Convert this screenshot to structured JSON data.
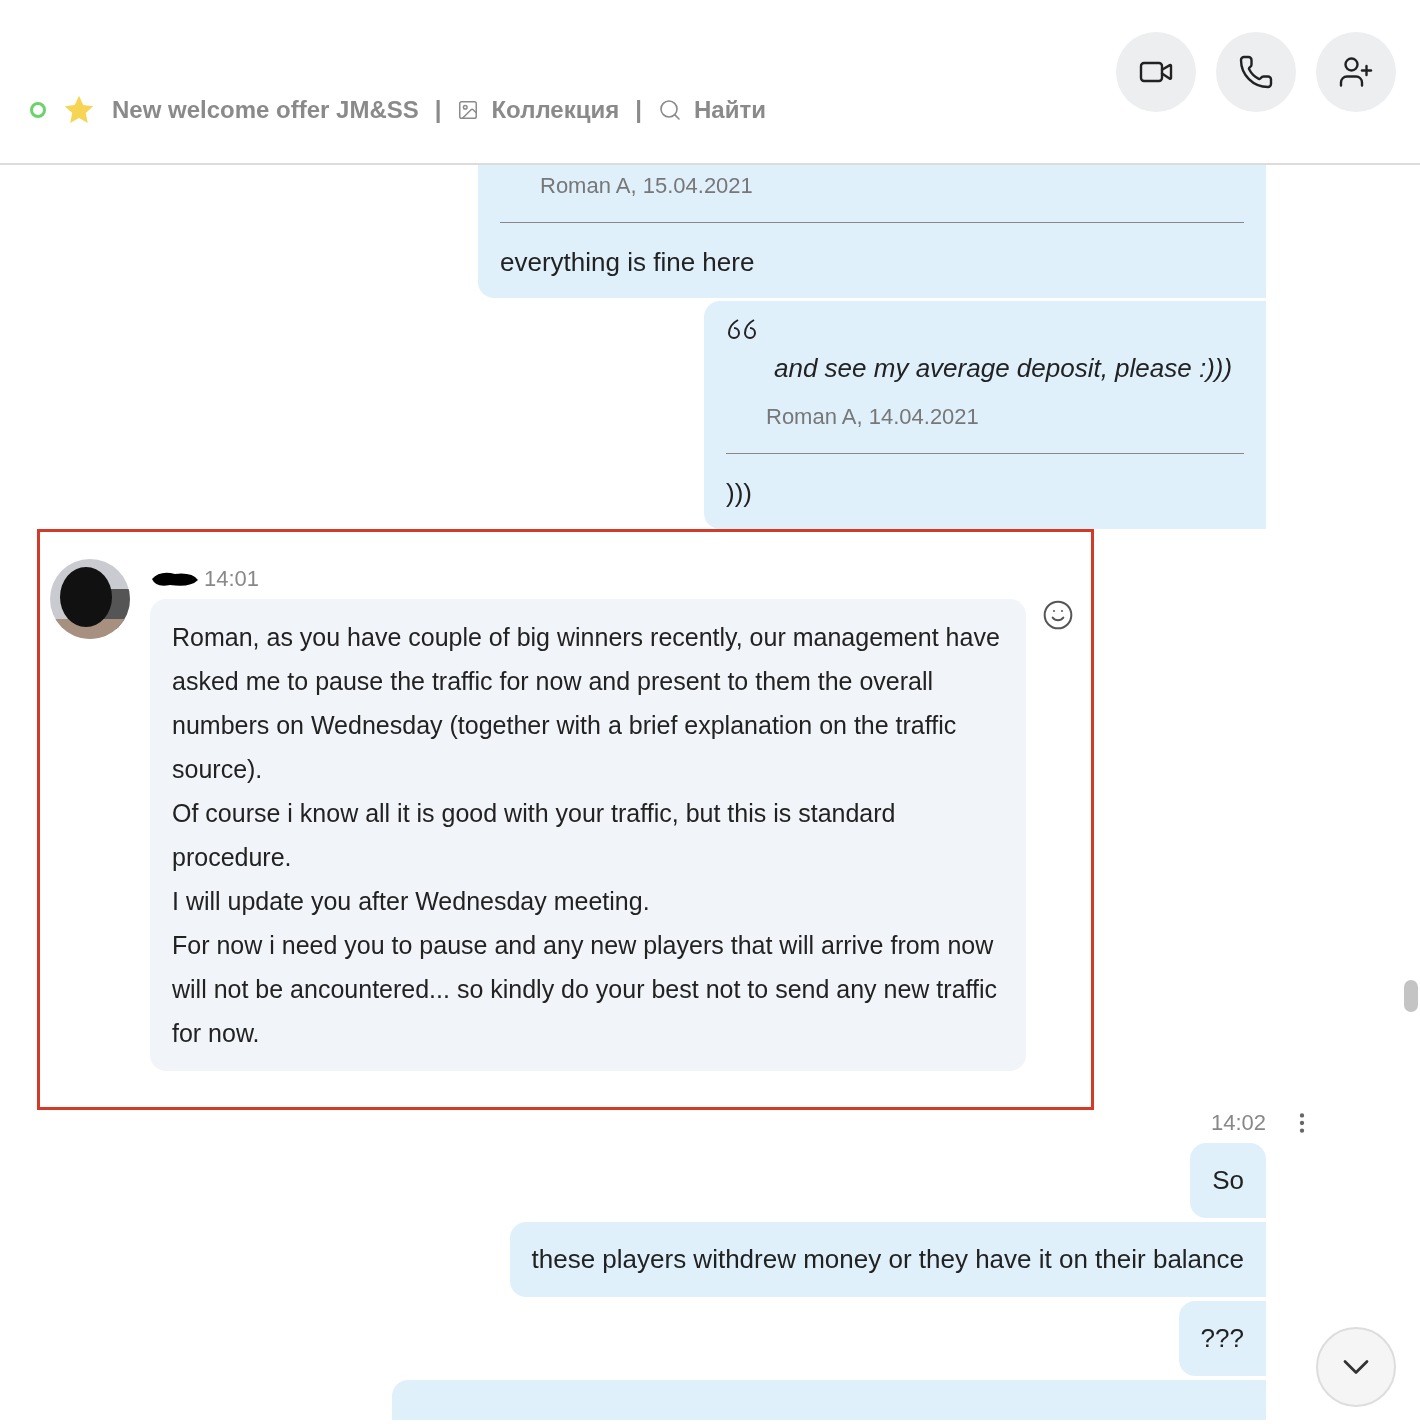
{
  "header": {
    "status": {
      "online": true
    },
    "title": "New welcome offer JM&SS",
    "separator_1": "|",
    "gallery_link": "Коллекция",
    "separator_2": "|",
    "search_link": "Найти"
  },
  "call_buttons": [
    {
      "kind": "video"
    },
    {
      "kind": "audio"
    },
    {
      "kind": "add_person"
    }
  ],
  "messages": [
    {
      "kind": "reply",
      "quote_author": "Roman A, 15.04.2021",
      "text": "everything is fine here"
    },
    {
      "kind": "reply",
      "quote_text": "and see my average deposit, please :)))",
      "quote_author": "Roman A, 14.04.2021",
      "text": ")))"
    },
    {
      "kind": "incoming",
      "time": "14:01",
      "highlighted": true,
      "paragraphs": [
        "Roman, as you have couple of big winners recently, our management have asked me to pause the traffic for now and present to them the overall numbers on Wednesday (together with a brief explanation on the traffic source).",
        "Of course i know all it is good with your traffic, but this is standard procedure.",
        "I will update you after Wednesday meeting.",
        "For now i need you to pause and any new players that will arrive from now will not be ancountered... so kindly do your best not to send any new traffic for now."
      ]
    },
    {
      "kind": "outgoing_group",
      "time": "14:02",
      "bubbles": [
        {
          "kind": "text",
          "text": "So"
        },
        {
          "kind": "text",
          "text": "these players withdrew money or they have it on their balance"
        },
        {
          "kind": "text",
          "text": "???"
        },
        {
          "kind": "partial"
        }
      ]
    }
  ]
}
